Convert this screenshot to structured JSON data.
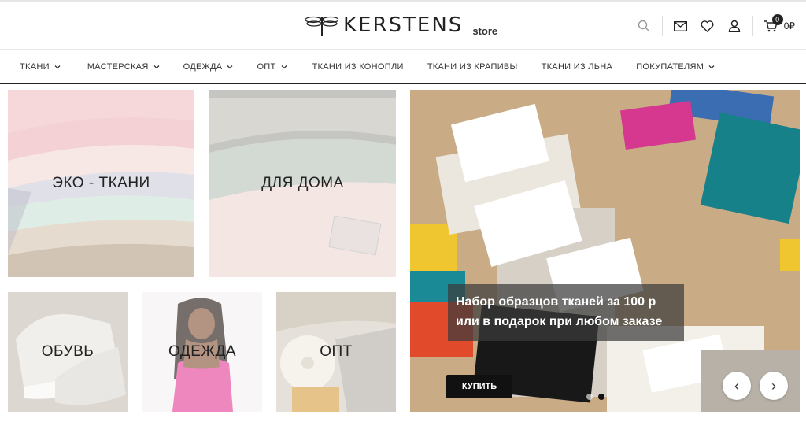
{
  "header": {
    "brand": "KERSTENS",
    "brand_suffix": "store",
    "icons": [
      "search-icon",
      "mail-icon",
      "heart-icon",
      "user-icon",
      "cart-icon"
    ],
    "cart_count": "0",
    "cart_total": "0₽"
  },
  "nav": {
    "items": [
      {
        "label": "ТКАНИ",
        "dropdown": true
      },
      {
        "label": "МАСТЕРСКАЯ",
        "dropdown": true
      },
      {
        "label": "ОДЕЖДА",
        "dropdown": true
      },
      {
        "label": "ОПТ",
        "dropdown": true
      },
      {
        "label": "ТКАНИ ИЗ КОНОПЛИ",
        "dropdown": false
      },
      {
        "label": "ТКАНИ ИЗ КРАПИВЫ",
        "dropdown": false
      },
      {
        "label": "ТКАНИ ИЗ ЛЬНА",
        "dropdown": false
      },
      {
        "label": "ПОКУПАТЕЛЯМ",
        "dropdown": true
      }
    ]
  },
  "tiles": [
    {
      "label": "ЭКО - ТКАНИ"
    },
    {
      "label": "ДЛЯ ДОМА"
    },
    {
      "label": "ОБУВЬ"
    },
    {
      "label": "ОДЕЖДА"
    },
    {
      "label": "ОПТ"
    }
  ],
  "slider": {
    "line1": "Набор образцов тканей за 100 р",
    "line2": "или в подарок при любом заказе",
    "button": "КУПИТЬ",
    "prev": "‹",
    "next": "›",
    "slides_count": 2,
    "active_slide": 2
  },
  "colors": {
    "accent": "#111111",
    "nav_border": "#222222"
  }
}
